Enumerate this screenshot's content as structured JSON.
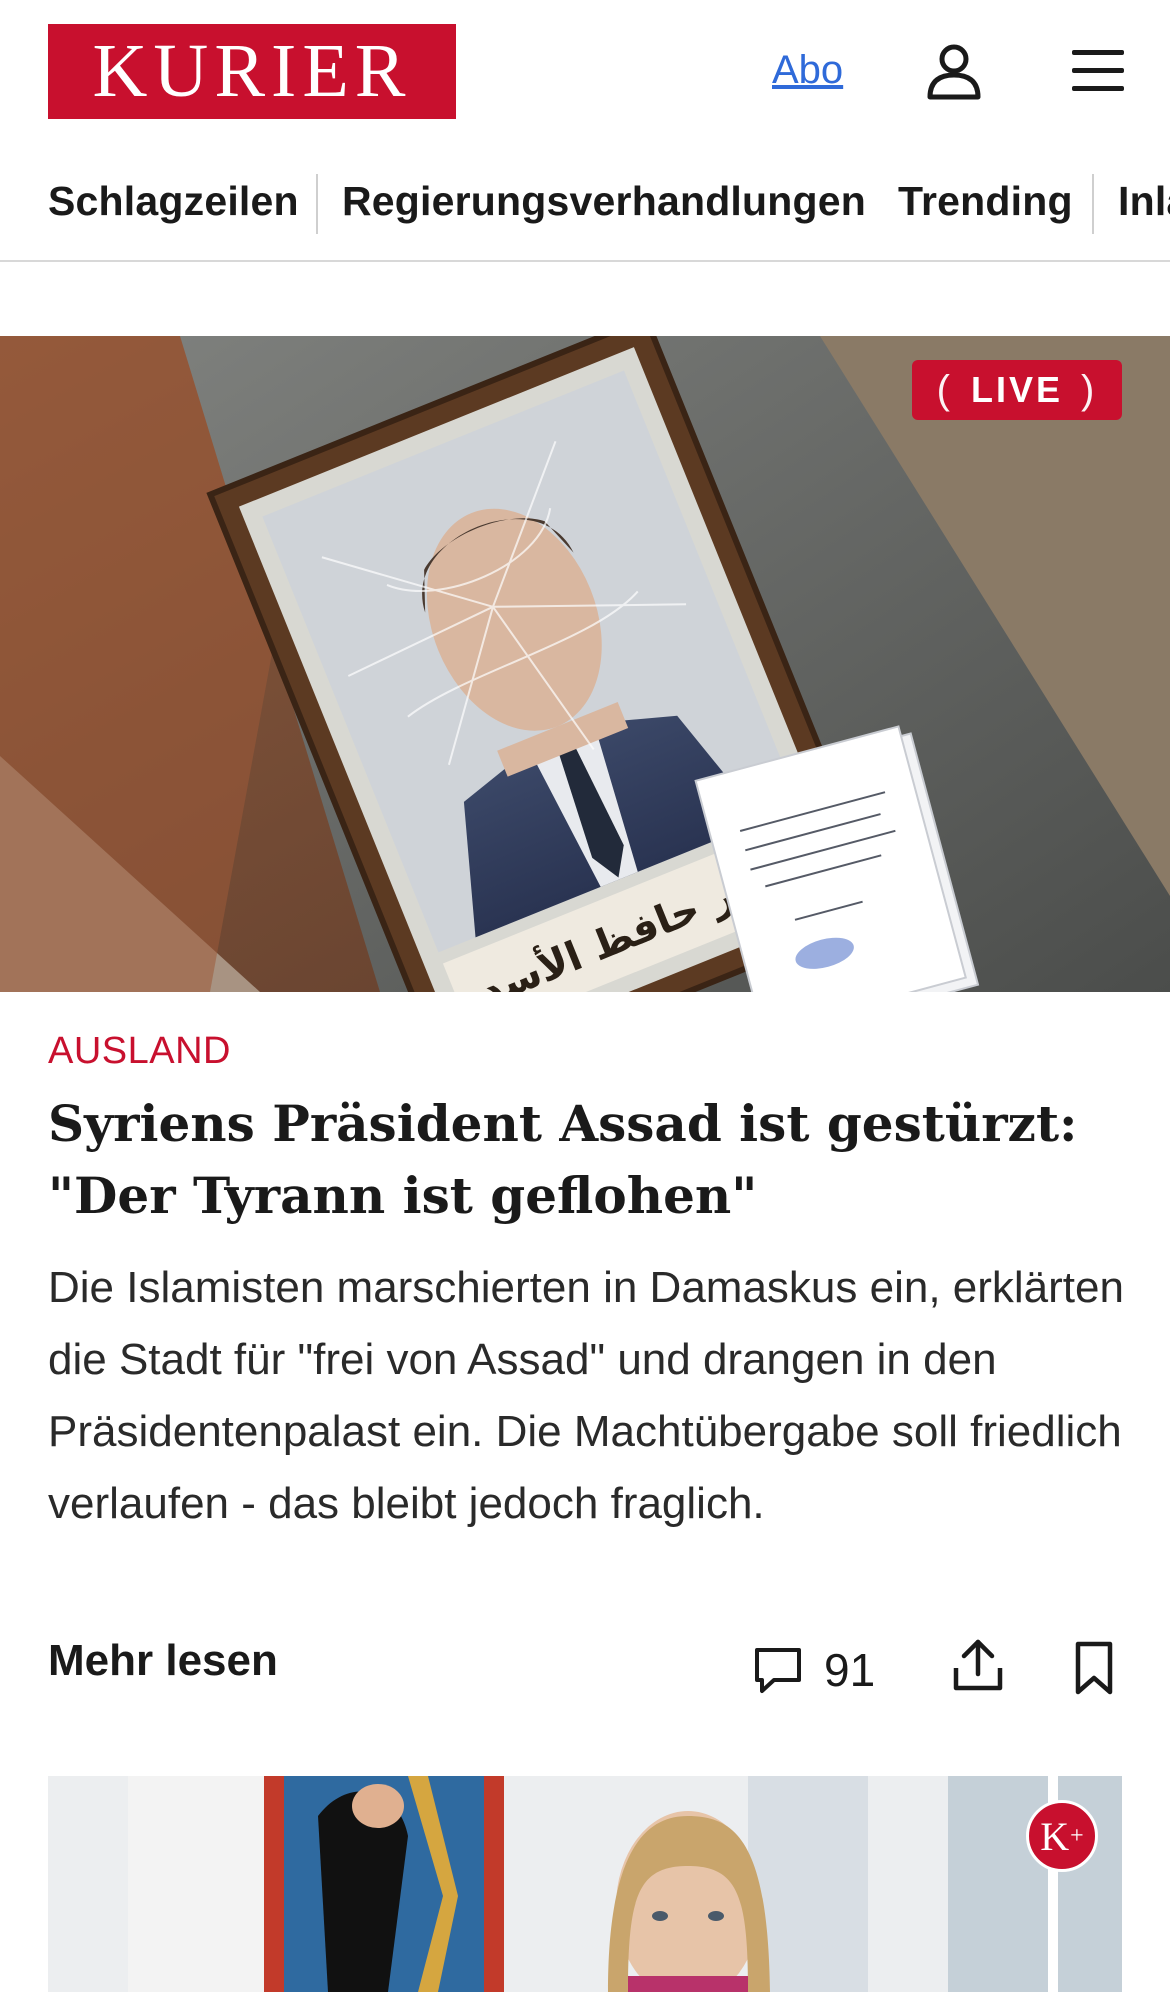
{
  "header": {
    "logo_text": "KURIER",
    "abo_label": "Abo",
    "user_icon": "user-icon",
    "menu_icon": "hamburger-menu-icon"
  },
  "nav": {
    "items": [
      {
        "label": "Schlagzeilen"
      },
      {
        "label": "Regierungsverhandlungen"
      },
      {
        "label": "Trending"
      },
      {
        "label": "Inland"
      }
    ]
  },
  "hero": {
    "live_label": "LIVE",
    "image_caption_text": "بشار حافظ الأسد"
  },
  "article": {
    "category": "AUSLAND",
    "headline": "Syriens Präsident Assad ist gestürzt: \"Der Tyrann ist geflohen\"",
    "teaser": "Die Islamisten marschierten in Damaskus ein, erklärten die Stadt für \"frei von Assad\" und drangen in den Präsidentenpalast ein. Die Machtübergabe soll friedlich verlaufen - das bleibt jedoch fraglich.",
    "more_label": "Mehr lesen",
    "comment_count": "91",
    "comment_icon": "comment-icon",
    "share_icon": "share-icon",
    "bookmark_icon": "bookmark-icon"
  },
  "second_article": {
    "badge_label": "K",
    "badge_plus": "+"
  },
  "colors": {
    "brand_red": "#c8102e",
    "link_blue": "#2f6ad9",
    "text": "#1a1a1a"
  }
}
